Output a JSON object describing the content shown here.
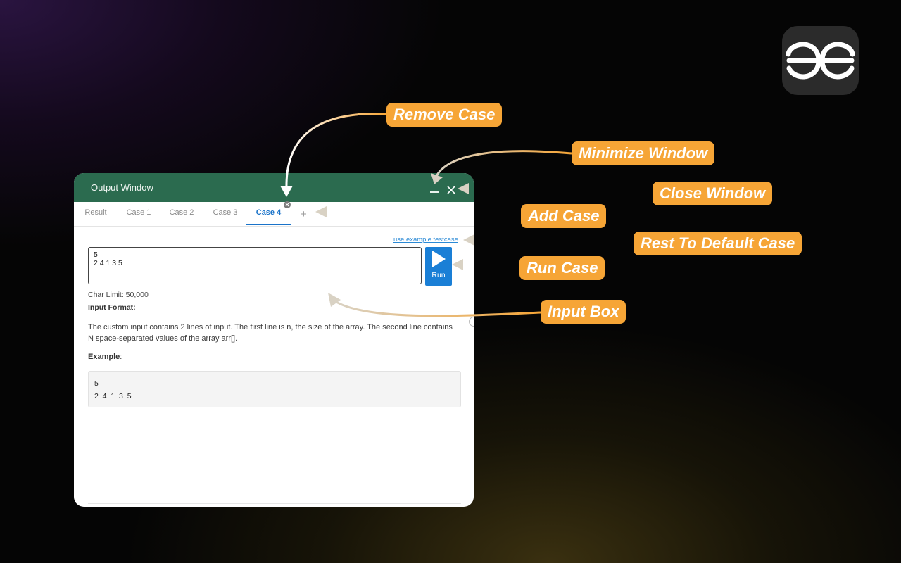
{
  "window": {
    "title": "Output Window",
    "tabs": [
      {
        "label": "Result",
        "active": false
      },
      {
        "label": "Case 1",
        "active": false
      },
      {
        "label": "Case 2",
        "active": false
      },
      {
        "label": "Case 3",
        "active": false
      },
      {
        "label": "Case 4",
        "active": true
      }
    ],
    "add_tab_label": "+",
    "example_link": "use example testcase",
    "input_value": "5\n2 4 1 3 5",
    "run_label": "Run",
    "char_limit": "Char Limit: 50,000",
    "input_format_label": "Input Format:",
    "description": "The custom input contains 2 lines of input. The first line is n, the size of the array. The second line contains N space-separated values of the array arr[].",
    "example_label": "Example",
    "example_suffix": ":",
    "example_lines": [
      "5",
      "2  4  1  3  5"
    ]
  },
  "callouts": {
    "remove_case": "Remove Case",
    "minimize_window": "Minimize Window",
    "close_window": "Close Window",
    "add_case": "Add Case",
    "reset_default": "Rest To Default Case",
    "run_case": "Run Case",
    "input_box": "Input Box"
  },
  "colors": {
    "titlebar": "#2b6b4f",
    "active_tab": "#1a73c9",
    "run_button": "#1a7fd6",
    "callout": "#f6a536",
    "logo_bg": "#2b2b2b"
  },
  "icons": {
    "logo": "gfg-logo-icon",
    "minimize": "minimize-icon",
    "close": "close-icon",
    "remove_case": "remove-case-icon",
    "add": "plus-icon",
    "run": "play-icon"
  }
}
